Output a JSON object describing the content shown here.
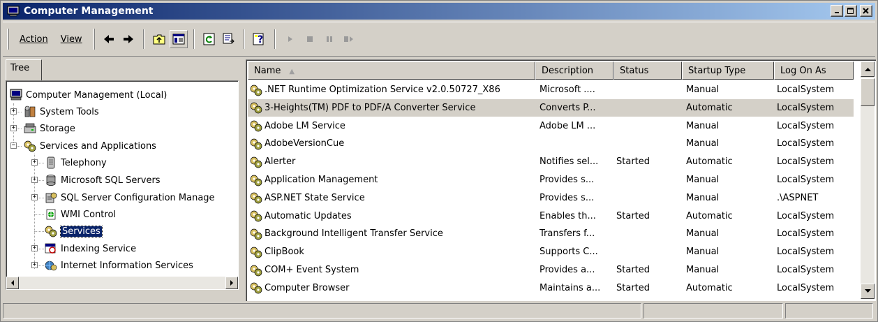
{
  "window": {
    "title": "Computer Management"
  },
  "menu": {
    "action": "Action",
    "view": "View"
  },
  "toolbar_icons": [
    "back-arrow-icon",
    "forward-arrow-icon",
    "up-folder-icon",
    "show-hide-tree-icon",
    "refresh-icon",
    "export-list-icon",
    "help-icon",
    "play-icon",
    "stop-icon",
    "pause-icon",
    "restart-icon"
  ],
  "tree": {
    "tab_label": "Tree",
    "items": [
      {
        "label": "Computer Management (Local)"
      },
      {
        "label": "System Tools"
      },
      {
        "label": "Storage"
      },
      {
        "label": "Services and Applications"
      },
      {
        "label": "Telephony"
      },
      {
        "label": "Microsoft SQL Servers"
      },
      {
        "label": "SQL Server Configuration Manage"
      },
      {
        "label": "WMI Control"
      },
      {
        "label": "Services"
      },
      {
        "label": "Indexing Service"
      },
      {
        "label": "Internet Information Services"
      }
    ]
  },
  "list": {
    "columns": [
      "Name",
      "Description",
      "Status",
      "Startup Type",
      "Log On As"
    ],
    "sort_indicator": "▲",
    "rows": [
      {
        "name": ".NET Runtime Optimization Service v2.0.50727_X86",
        "description": "Microsoft ....",
        "status": "",
        "startup": "Manual",
        "logon": "LocalSystem"
      },
      {
        "name": "3-Heights(TM) PDF to PDF/A Converter Service",
        "description": "Converts P...",
        "status": "",
        "startup": "Automatic",
        "logon": "LocalSystem"
      },
      {
        "name": "Adobe LM Service",
        "description": "Adobe LM ...",
        "status": "",
        "startup": "Manual",
        "logon": "LocalSystem"
      },
      {
        "name": "AdobeVersionCue",
        "description": "",
        "status": "",
        "startup": "Manual",
        "logon": "LocalSystem"
      },
      {
        "name": "Alerter",
        "description": "Notifies sel...",
        "status": "Started",
        "startup": "Automatic",
        "logon": "LocalSystem"
      },
      {
        "name": "Application Management",
        "description": "Provides s...",
        "status": "",
        "startup": "Manual",
        "logon": "LocalSystem"
      },
      {
        "name": "ASP.NET State Service",
        "description": "Provides s...",
        "status": "",
        "startup": "Manual",
        "logon": ".\\ASPNET"
      },
      {
        "name": "Automatic Updates",
        "description": "Enables th...",
        "status": "Started",
        "startup": "Automatic",
        "logon": "LocalSystem"
      },
      {
        "name": "Background Intelligent Transfer Service",
        "description": "Transfers f...",
        "status": "",
        "startup": "Manual",
        "logon": "LocalSystem"
      },
      {
        "name": "ClipBook",
        "description": "Supports C...",
        "status": "",
        "startup": "Manual",
        "logon": "LocalSystem"
      },
      {
        "name": "COM+ Event System",
        "description": "Provides a...",
        "status": "Started",
        "startup": "Manual",
        "logon": "LocalSystem"
      },
      {
        "name": "Computer Browser",
        "description": "Maintains a...",
        "status": "Started",
        "startup": "Automatic",
        "logon": "LocalSystem"
      }
    ],
    "highlighted_row": 2
  },
  "colors": {
    "title_start": "#0a246a",
    "title_end": "#a6caf0",
    "face": "#d4d0c8",
    "selection": "#0a246a"
  }
}
